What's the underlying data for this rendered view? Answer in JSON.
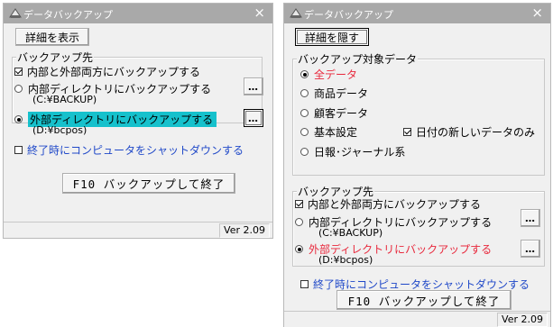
{
  "left_window": {
    "title": "データバックアップ",
    "close_glyph": "×",
    "show_details_label": "詳細を表示",
    "backup_group_label": "バックアップ先",
    "options": {
      "both": "内部と外部両方にバックアップする",
      "internal": "内部ディレクトリにバックアップする",
      "internal_path": "(C:¥BACKUP)",
      "external": "外部ディレクトリにバックアップする",
      "external_path": "(D:¥bcpos)"
    },
    "browse_label": "…",
    "shutdown_label": "終了時にコンピュータをシャットダウンする",
    "f10_label": "F10 バックアップして終了",
    "version": "Ver 2.09"
  },
  "right_window": {
    "title": "データバックアップ",
    "close_glyph": "×",
    "hide_details_label": "詳細を隠す",
    "target_group_label": "バックアップ対象データ",
    "targets": {
      "all": "全データ",
      "products": "商品データ",
      "customers": "顧客データ",
      "basic": "基本設定",
      "daily": "日報･ジャーナル系"
    },
    "newer_only_label": "日付の新しいデータのみ",
    "backup_group_label": "バックアップ先",
    "options": {
      "both": "内部と外部両方にバックアップする",
      "internal": "内部ディレクトリにバックアップする",
      "internal_path": "(C:¥BACKUP)",
      "external": "外部ディレクトリにバックアップする",
      "external_path": "(D:¥bcpos)"
    },
    "browse_label": "…",
    "shutdown_label": "終了時にコンピュータをシャットダウンする",
    "f10_label": "F10 バックアップして終了",
    "version": "Ver 2.09"
  },
  "colors": {
    "titlebar": "#a9a9a9",
    "highlight": "#16c1cc",
    "selected_red": "#e8283c",
    "link_blue": "#1f48c8"
  },
  "icons": {
    "app": "backup-app-icon",
    "close": "close-icon"
  }
}
